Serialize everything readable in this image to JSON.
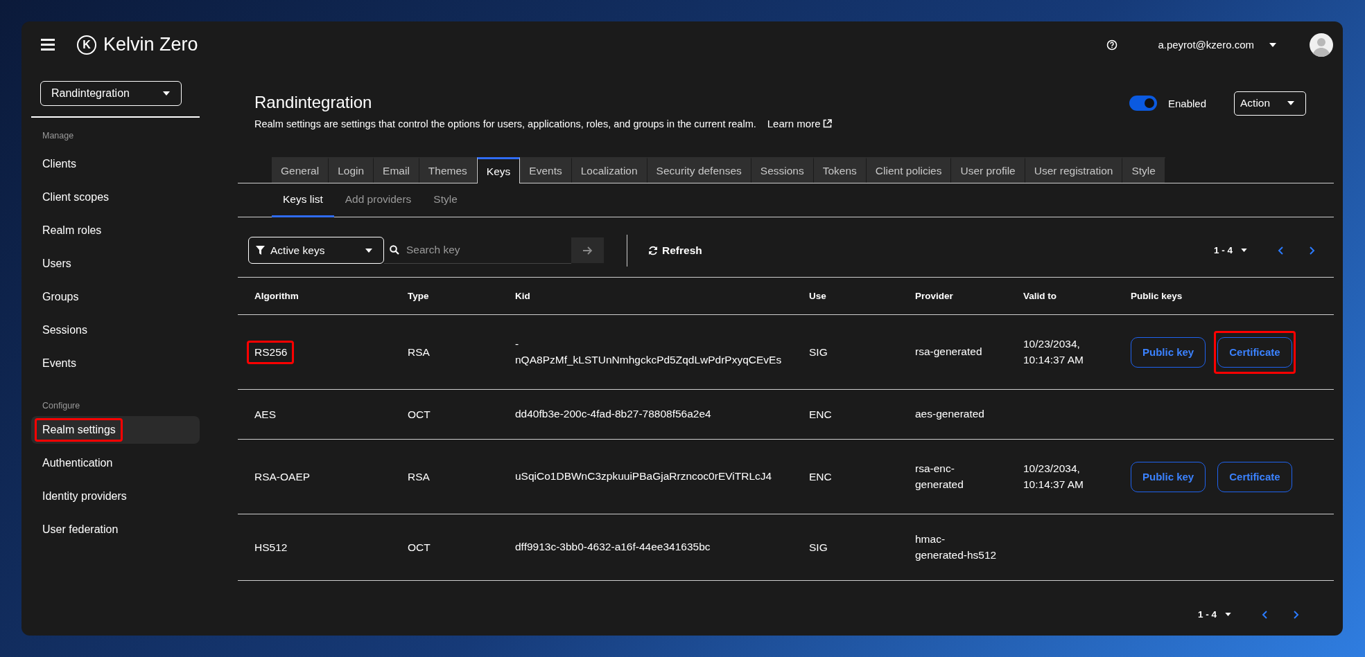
{
  "header": {
    "logo_mark": "K",
    "brand": "Kelvin Zero",
    "user": "a.peyrot@kzero.com"
  },
  "sidebar": {
    "realm_selector": "Randintegration",
    "sections": [
      {
        "heading": "Manage",
        "items": [
          {
            "label": "Clients",
            "selected": false,
            "highlighted": false
          },
          {
            "label": "Client scopes",
            "selected": false,
            "highlighted": false
          },
          {
            "label": "Realm roles",
            "selected": false,
            "highlighted": false
          },
          {
            "label": "Users",
            "selected": false,
            "highlighted": false
          },
          {
            "label": "Groups",
            "selected": false,
            "highlighted": false
          },
          {
            "label": "Sessions",
            "selected": false,
            "highlighted": false
          },
          {
            "label": "Events",
            "selected": false,
            "highlighted": false
          }
        ]
      },
      {
        "heading": "Configure",
        "items": [
          {
            "label": "Realm settings",
            "selected": true,
            "highlighted": true
          },
          {
            "label": "Authentication",
            "selected": false,
            "highlighted": false
          },
          {
            "label": "Identity providers",
            "selected": false,
            "highlighted": false
          },
          {
            "label": "User federation",
            "selected": false,
            "highlighted": false
          }
        ]
      }
    ]
  },
  "page": {
    "title": "Randintegration",
    "description": "Realm settings are settings that control the options for users, applications, roles, and groups in the current realm.",
    "learn_more": "Learn more",
    "enabled": {
      "label": "Enabled",
      "on": true
    },
    "action": "Action"
  },
  "tabs": [
    {
      "label": "General",
      "selected": false
    },
    {
      "label": "Login",
      "selected": false
    },
    {
      "label": "Email",
      "selected": false
    },
    {
      "label": "Themes",
      "selected": false
    },
    {
      "label": "Keys",
      "selected": true
    },
    {
      "label": "Events",
      "selected": false
    },
    {
      "label": "Localization",
      "selected": false
    },
    {
      "label": "Security defenses",
      "selected": false
    },
    {
      "label": "Sessions",
      "selected": false
    },
    {
      "label": "Tokens",
      "selected": false
    },
    {
      "label": "Client policies",
      "selected": false
    },
    {
      "label": "User profile",
      "selected": false
    },
    {
      "label": "User registration",
      "selected": false
    },
    {
      "label": "Style",
      "selected": false
    }
  ],
  "subtabs": [
    {
      "label": "Keys list",
      "selected": true
    },
    {
      "label": "Add providers",
      "selected": false
    },
    {
      "label": "Style",
      "selected": false
    }
  ],
  "toolbar": {
    "filter": "Active keys",
    "search": {
      "placeholder": "Search key"
    },
    "refresh": "Refresh",
    "pagination": "1 - 4"
  },
  "table": {
    "columns": [
      "Algorithm",
      "Type",
      "Kid",
      "Use",
      "Provider",
      "Valid to",
      "Public keys"
    ],
    "rows": [
      {
        "algorithm": "RS256",
        "highlighted": true,
        "type": "RSA",
        "kid": [
          "-",
          "nQA8PzMf_kLSTUnNmhgckcPd5ZqdLwPdrPxyqCEvEs"
        ],
        "use": "SIG",
        "provider": [
          "rsa-generated"
        ],
        "valid_to": [
          "10/23/2034,",
          "10:14:37 AM"
        ],
        "buttons": [
          {
            "label": "Public key",
            "highlighted": false
          },
          {
            "label": "Certificate",
            "highlighted": true
          }
        ]
      },
      {
        "algorithm": "AES",
        "highlighted": false,
        "type": "OCT",
        "kid": [
          "dd40fb3e-200c-4fad-8b27-78808f56a2e4"
        ],
        "use": "ENC",
        "provider": [
          "aes-generated"
        ],
        "valid_to": [],
        "buttons": []
      },
      {
        "algorithm": "RSA-OAEP",
        "highlighted": false,
        "type": "RSA",
        "kid": [
          "uSqiCo1DBWnC3zpkuuiPBaGjaRrzncoc0rEViTRLcJ4"
        ],
        "use": "ENC",
        "provider": [
          "rsa-enc-",
          "generated"
        ],
        "valid_to": [
          "10/23/2034,",
          "10:14:37 AM"
        ],
        "buttons": [
          {
            "label": "Public key",
            "highlighted": false
          },
          {
            "label": "Certificate",
            "highlighted": false
          }
        ]
      },
      {
        "algorithm": "HS512",
        "highlighted": false,
        "type": "OCT",
        "kid": [
          "dff9913c-3bb0-4632-a16f-44ee341635bc"
        ],
        "use": "SIG",
        "provider": [
          "hmac-",
          "generated-hs512"
        ],
        "valid_to": [],
        "buttons": []
      }
    ]
  },
  "footer_pagination": "1 - 4"
}
